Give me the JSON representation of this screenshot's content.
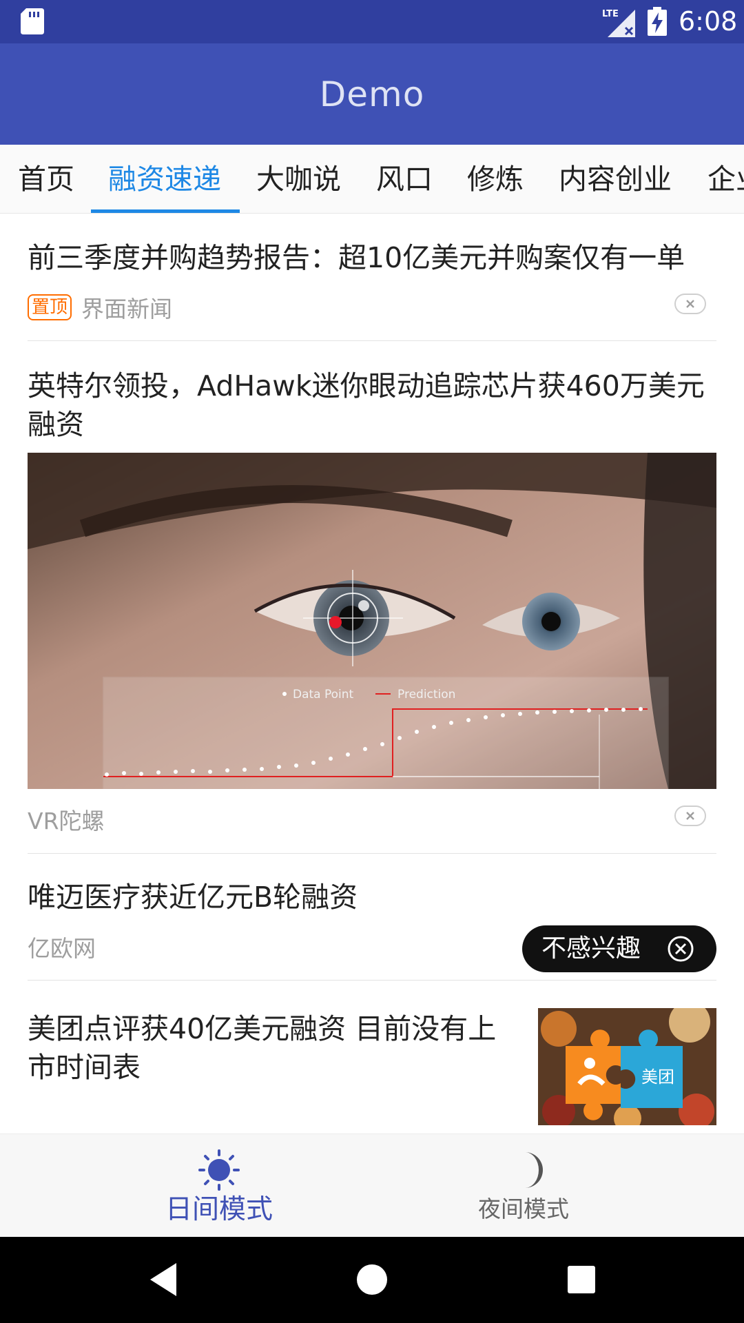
{
  "status_bar": {
    "time": "6:08",
    "icons": [
      "sd-card-icon",
      "lte-signal-icon",
      "battery-charging-icon"
    ]
  },
  "app_bar": {
    "title": "Demo"
  },
  "tabs": [
    {
      "label": "首页"
    },
    {
      "label": "融资速递"
    },
    {
      "label": "大咖说"
    },
    {
      "label": "风口"
    },
    {
      "label": "修炼"
    },
    {
      "label": "内容创业"
    },
    {
      "label": "企业"
    }
  ],
  "active_tab": "融资速递",
  "feed": {
    "articles": [
      {
        "title": "前三季度并购趋势报告：超10亿美元并购案仅有一单",
        "badge": "置顶",
        "source": "界面新闻"
      },
      {
        "title": "英特尔领投，AdHawk迷你眼动追踪芯片获460万美元融资",
        "source": "VR陀螺",
        "image_legend": [
          "Data Point",
          "Prediction"
        ]
      },
      {
        "title": "唯迈医疗获近亿元B轮融资",
        "source": "亿欧网"
      },
      {
        "title": "美团点评获40亿美元融资 目前没有上市时间表",
        "thumb_text": "美团"
      }
    ],
    "popup": {
      "label": "不感兴趣"
    }
  },
  "bottom_nav": {
    "items": [
      {
        "label": "日间模式",
        "icon": "sun-icon"
      },
      {
        "label": "夜间模式",
        "icon": "moon-icon"
      }
    ]
  },
  "colors": {
    "status_bar": "#303f9f",
    "app_bar": "#3f51b5",
    "tab_active": "#1e88e5",
    "badge": "#ff6d00"
  }
}
